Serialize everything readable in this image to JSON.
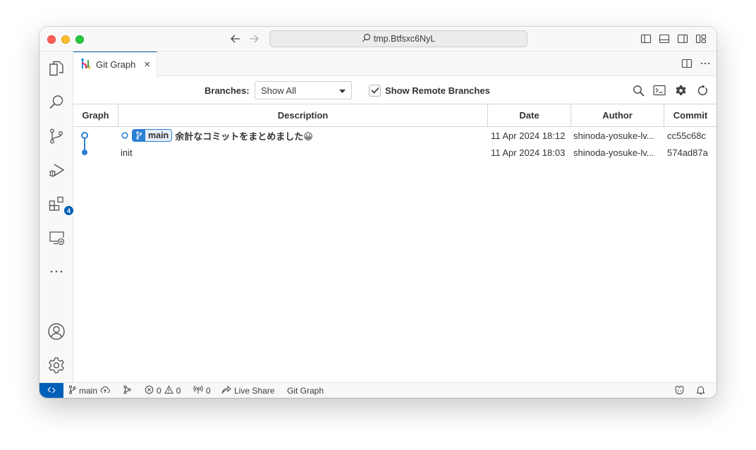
{
  "window": {
    "search_text": "tmp.Btfsxc6NyL"
  },
  "tab": {
    "label": "Git Graph",
    "icon": "git-graph-icon"
  },
  "controls": {
    "branches_label": "Branches:",
    "branches_value": "Show All",
    "show_remote_label": "Show Remote Branches",
    "show_remote_checked": true
  },
  "table": {
    "headers": [
      "Graph",
      "Description",
      "Date",
      "Author",
      "Commit"
    ],
    "rows": [
      {
        "ref": "main",
        "message": "余計なコミットをまとめました😀",
        "date": "11 Apr 2024 18:12",
        "author": "shinoda-yosuke-lv...",
        "commit": "cc55c68c"
      },
      {
        "ref": "",
        "message": "init",
        "date": "11 Apr 2024 18:03",
        "author": "shinoda-yosuke-lv...",
        "commit": "574ad87a"
      }
    ]
  },
  "activitybar": {
    "extensions_badge": "4"
  },
  "statusbar": {
    "branch": "main",
    "errors": "0",
    "warnings": "0",
    "ports": "0",
    "live_share": "Live Share",
    "git_graph": "Git Graph"
  },
  "colors": {
    "accent": "#005fb8",
    "graph_blue": "#2b7fd6"
  }
}
